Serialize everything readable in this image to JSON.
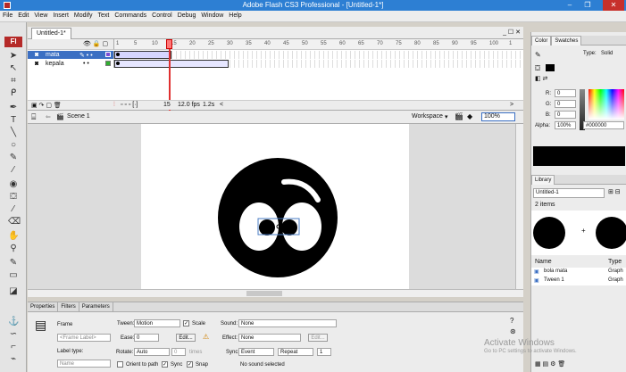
{
  "window": {
    "title": "Adobe Flash CS3 Professional - [Untitled-1*]",
    "minimize": "–",
    "maximize": "❐",
    "close": "✕"
  },
  "menu": [
    "File",
    "Edit",
    "View",
    "Insert",
    "Modify",
    "Text",
    "Commands",
    "Control",
    "Debug",
    "Window",
    "Help"
  ],
  "toolbox": {
    "logo": "Fl"
  },
  "document": {
    "tab": "Untitled-1*",
    "controls": "_ ☐ ✕"
  },
  "timeline": {
    "frame_numbers": [
      "1",
      "5",
      "10",
      "15",
      "20",
      "25",
      "30",
      "35",
      "40",
      "45",
      "50",
      "55",
      "60",
      "65",
      "70",
      "75",
      "80",
      "85",
      "90",
      "95",
      "100",
      "1"
    ],
    "layers": [
      {
        "name": "mata",
        "selected": true
      },
      {
        "name": "kepala",
        "selected": false
      }
    ],
    "footer": {
      "frame": "15",
      "fps": "12.0 fps",
      "time": "1.2s"
    }
  },
  "scene": {
    "name": "Scene 1",
    "workspace": "Workspace",
    "zoom": "100%"
  },
  "properties": {
    "tabs": [
      "Properties",
      "Filters",
      "Parameters"
    ],
    "frame_label": "Frame",
    "frame_placeholder": "<Frame Label>",
    "label_type_label": "Label type:",
    "label_type_value": "Name",
    "tween_label": "Tween:",
    "tween_value": "Motion",
    "scale_label": "Scale",
    "ease_label": "Ease:",
    "ease_value": "0",
    "edit_button": "Edit...",
    "rotate_label": "Rotate:",
    "rotate_value": "Auto",
    "rotate_times_value": "0",
    "times_label": "times",
    "orient_label": "Orient to path",
    "sync_label": "Sync",
    "snap_label": "Snap",
    "sound_label": "Sound:",
    "sound_value": "None",
    "effect_label": "Effect:",
    "effect_value": "None",
    "effect_edit": "Edit...",
    "sync2_label": "Sync:",
    "sync2_event": "Event",
    "sync2_repeat": "Repeat",
    "sync2_count": "1",
    "no_sound": "No sound selected"
  },
  "color_panel": {
    "tabs": [
      "Color",
      "Swatches"
    ],
    "type_label": "Type:",
    "type_value": "Solid",
    "r_label": "R:",
    "r_value": "0",
    "g_label": "G:",
    "g_value": "0",
    "b_label": "B:",
    "b_value": "0",
    "alpha_label": "Alpha:",
    "alpha_value": "100%",
    "hex": "#000000"
  },
  "library_panel": {
    "tab": "Library",
    "doc": "Untitled-1",
    "count": "2 items",
    "col_name": "Name",
    "col_type": "Type",
    "items": [
      {
        "name": "bola mata",
        "type": "Graph"
      },
      {
        "name": "Tween 1",
        "type": "Graph"
      }
    ]
  },
  "watermark": {
    "line1": "Activate Windows",
    "line2": "Go to PC settings to activate Windows."
  }
}
